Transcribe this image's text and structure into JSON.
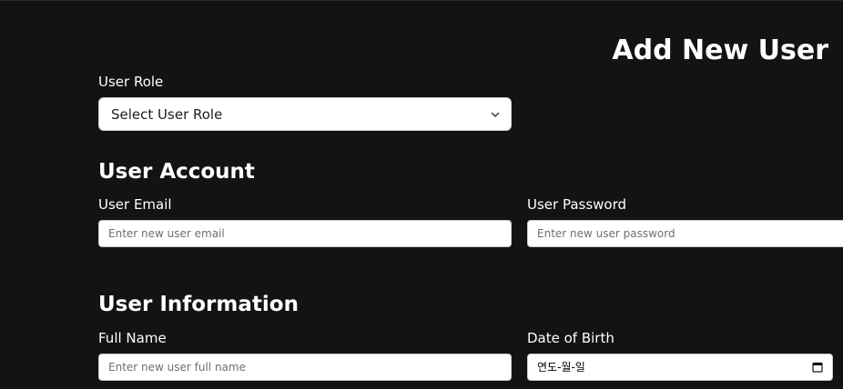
{
  "page": {
    "title": "Add New User"
  },
  "user_role": {
    "label": "User Role",
    "select_value": "Select User Role",
    "icon": "chevron-down-icon"
  },
  "account": {
    "title": "User Account",
    "email_label": "User Email",
    "email_placeholder": "Enter new user email",
    "password_label": "User Password",
    "password_placeholder": "Enter new user password"
  },
  "information": {
    "title": "User Information",
    "full_name_label": "Full Name",
    "full_name_placeholder": "Enter new user full name",
    "dob_label": "Date of Birth",
    "dob_value": "연도-월-일",
    "dob_icon": "calendar-icon"
  },
  "colors": {
    "background": "#131313",
    "text": "#ffffff",
    "field_background": "#ffffff"
  }
}
